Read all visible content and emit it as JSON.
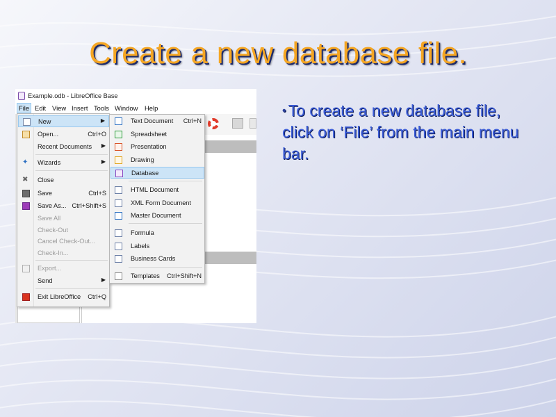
{
  "slide": {
    "title": "Create a new database file.",
    "bullet": "To create a new database file, click on ‘File’ from the main menu bar."
  },
  "window": {
    "title": "Example.odb - LibreOffice Base"
  },
  "menubar": {
    "items": [
      "File",
      "Edit",
      "View",
      "Insert",
      "Tools",
      "Window",
      "Help"
    ]
  },
  "file_menu": {
    "items": [
      {
        "label": "New",
        "shortcut": "",
        "icon": "new-document-icon",
        "submenu": true,
        "highlighted": true,
        "disabled": false
      },
      {
        "label": "Open...",
        "shortcut": "Ctrl+O",
        "icon": "open-folder-icon",
        "submenu": false,
        "highlighted": false,
        "disabled": false
      },
      {
        "label": "Recent Documents",
        "shortcut": "",
        "icon": "",
        "submenu": true,
        "highlighted": false,
        "disabled": false
      },
      {
        "label": "Wizards",
        "shortcut": "",
        "icon": "wizard-icon",
        "submenu": true,
        "highlighted": false,
        "disabled": false
      },
      {
        "label": "Close",
        "shortcut": "",
        "icon": "close-icon",
        "submenu": false,
        "highlighted": false,
        "disabled": false
      },
      {
        "label": "Save",
        "shortcut": "Ctrl+S",
        "icon": "save-icon",
        "submenu": false,
        "highlighted": false,
        "disabled": false
      },
      {
        "label": "Save As...",
        "shortcut": "Ctrl+Shift+S",
        "icon": "save-as-icon",
        "submenu": false,
        "highlighted": false,
        "disabled": false
      },
      {
        "label": "Save All",
        "shortcut": "",
        "icon": "",
        "submenu": false,
        "highlighted": false,
        "disabled": true
      },
      {
        "label": "Check-Out",
        "shortcut": "",
        "icon": "",
        "submenu": false,
        "highlighted": false,
        "disabled": true
      },
      {
        "label": "Cancel Check-Out...",
        "shortcut": "",
        "icon": "",
        "submenu": false,
        "highlighted": false,
        "disabled": true
      },
      {
        "label": "Check-In...",
        "shortcut": "",
        "icon": "",
        "submenu": false,
        "highlighted": false,
        "disabled": true
      },
      {
        "label": "Export...",
        "shortcut": "",
        "icon": "export-icon",
        "submenu": false,
        "highlighted": false,
        "disabled": true
      },
      {
        "label": "Send",
        "shortcut": "",
        "icon": "",
        "submenu": true,
        "highlighted": false,
        "disabled": false
      },
      {
        "label": "Exit LibreOffice",
        "shortcut": "Ctrl+Q",
        "icon": "exit-icon",
        "submenu": false,
        "highlighted": false,
        "disabled": false
      }
    ]
  },
  "new_submenu": {
    "items": [
      {
        "label": "Text Document",
        "shortcut": "Ctrl+N",
        "icon": "text-document-icon",
        "highlighted": false
      },
      {
        "label": "Spreadsheet",
        "shortcut": "",
        "icon": "spreadsheet-icon",
        "highlighted": false
      },
      {
        "label": "Presentation",
        "shortcut": "",
        "icon": "presentation-icon",
        "highlighted": false
      },
      {
        "label": "Drawing",
        "shortcut": "",
        "icon": "drawing-icon",
        "highlighted": false
      },
      {
        "label": "Database",
        "shortcut": "",
        "icon": "database-icon",
        "highlighted": true
      },
      {
        "label": "HTML Document",
        "shortcut": "",
        "icon": "html-document-icon",
        "highlighted": false
      },
      {
        "label": "XML Form Document",
        "shortcut": "",
        "icon": "xml-form-icon",
        "highlighted": false
      },
      {
        "label": "Master Document",
        "shortcut": "",
        "icon": "master-document-icon",
        "highlighted": false
      },
      {
        "label": "Formula",
        "shortcut": "",
        "icon": "formula-icon",
        "highlighted": false
      },
      {
        "label": "Labels",
        "shortcut": "",
        "icon": "labels-icon",
        "highlighted": false
      },
      {
        "label": "Business Cards",
        "shortcut": "",
        "icon": "business-cards-icon",
        "highlighted": false
      },
      {
        "label": "Templates",
        "shortcut": "Ctrl+Shift+N",
        "icon": "templates-icon",
        "highlighted": false
      }
    ]
  },
  "colors": {
    "title": "#f5a623",
    "bullet_text": "#3a5bd6",
    "highlight": "#cce4f7"
  }
}
